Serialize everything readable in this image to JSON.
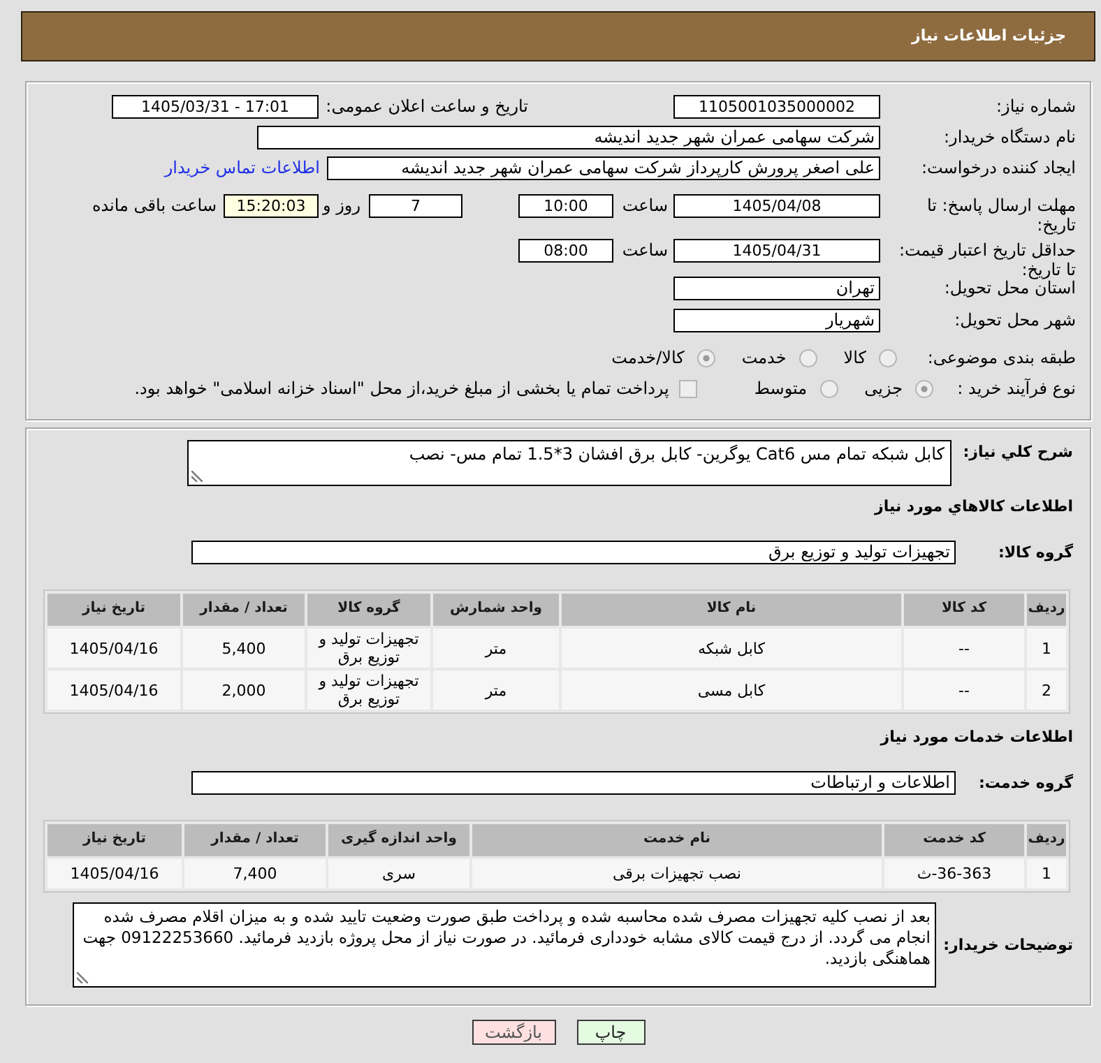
{
  "header": {
    "title": "جزئیات اطلاعات نیاز"
  },
  "need_number": {
    "label": "شماره نیاز:",
    "value": "1105001035000002"
  },
  "announcement": {
    "label": "تاریخ و ساعت اعلان عمومی:",
    "value": "1405/03/31 - 17:01"
  },
  "buyer_org": {
    "label": "نام دستگاه خریدار:",
    "value": "شرکت سهامی عمران شهر جدید اندیشه"
  },
  "requester": {
    "label": "ایجاد کننده درخواست:",
    "value": "علی اصغر پرورش کارپرداز شرکت سهامی عمران شهر جدید اندیشه",
    "contact_link": "اطلاعات تماس خریدار"
  },
  "response_deadline": {
    "label": "مهلت ارسال پاسخ: تا تاریخ:",
    "date": "1405/04/08",
    "time_label": "ساعت",
    "time": "10:00",
    "days": "7",
    "days_label": "روز و",
    "remaining": "15:20:03",
    "remaining_label": "ساعت باقی مانده"
  },
  "price_validity": {
    "label": "حداقل تاریخ اعتبار قیمت: تا تاریخ:",
    "date": "1405/04/31",
    "time_label": "ساعت",
    "time": "08:00"
  },
  "delivery_province": {
    "label": "استان محل تحویل:",
    "value": "تهران"
  },
  "delivery_city": {
    "label": "شهر محل تحویل:",
    "value": "شهریار"
  },
  "subject_category": {
    "label": "طبقه بندی موضوعی:",
    "options": [
      {
        "label": "کالا",
        "selected": false,
        "disabled": true
      },
      {
        "label": "خدمت",
        "selected": false,
        "disabled": true
      },
      {
        "label": "کالا/خدمت",
        "selected": true,
        "disabled": true
      }
    ]
  },
  "purchase_type": {
    "label": "نوع فرآیند خرید :",
    "options": [
      {
        "label": "جزیی",
        "selected": true,
        "disabled": true
      },
      {
        "label": "متوسط",
        "selected": false,
        "disabled": true
      }
    ],
    "treasury_payment": {
      "label": "پرداخت تمام یا بخشی از مبلغ خرید،از محل \"اسناد خزانه اسلامی\" خواهد بود.",
      "checked": false,
      "disabled": true
    }
  },
  "general_description": {
    "label": "شرح کلي نياز:",
    "value": "کابل شبکه تمام مس Cat6 یوگرین- کابل برق افشان 3*1.5 تمام مس- نصب"
  },
  "goods": {
    "title": "اطلاعات کالاهاي مورد نياز",
    "group_label": "گروه کالا:",
    "group": "تجهیزات تولید و توزیع برق",
    "columns": [
      "ردیف",
      "کد کالا",
      "نام کالا",
      "واحد شمارش",
      "گروه کالا",
      "تعداد / مقدار",
      "تاریخ نیاز"
    ],
    "rows": [
      [
        "1",
        "--",
        "کابل شبکه",
        "متر",
        "تجهیزات تولید و توزیع برق",
        "5,400",
        "1405/04/16"
      ],
      [
        "2",
        "--",
        "کابل مسی",
        "متر",
        "تجهیزات تولید و توزیع برق",
        "2,000",
        "1405/04/16"
      ]
    ]
  },
  "services": {
    "title": "اطلاعات خدمات مورد نياز",
    "group_label": "گروه خدمت:",
    "group": "اطلاعات و ارتباطات",
    "columns": [
      "ردیف",
      "کد خدمت",
      "نام خدمت",
      "واحد اندازه گیری",
      "تعداد / مقدار",
      "تاریخ نیاز"
    ],
    "rows": [
      [
        "1",
        "ث-36-363",
        "نصب تجهیزات برقی",
        "سری",
        "7,400",
        "1405/04/16"
      ]
    ]
  },
  "buyer_notes": {
    "label": "توضیحات خریدار:",
    "value": "بعد از نصب کلیه تجهیزات مصرف شده محاسبه شده و پرداخت طبق صورت وضعیت تایید شده و به میزان اقلام مصرف شده انجام می گردد. از درج قیمت کالای مشابه خودداری فرمائید. در صورت نیاز از محل پروژه بازدید فرمائید. 09122253660 جهت هماهنگی بازدید."
  },
  "buttons": [
    {
      "kind": "print",
      "label": "چاپ"
    },
    {
      "kind": "back",
      "label": "بازگشت"
    }
  ]
}
